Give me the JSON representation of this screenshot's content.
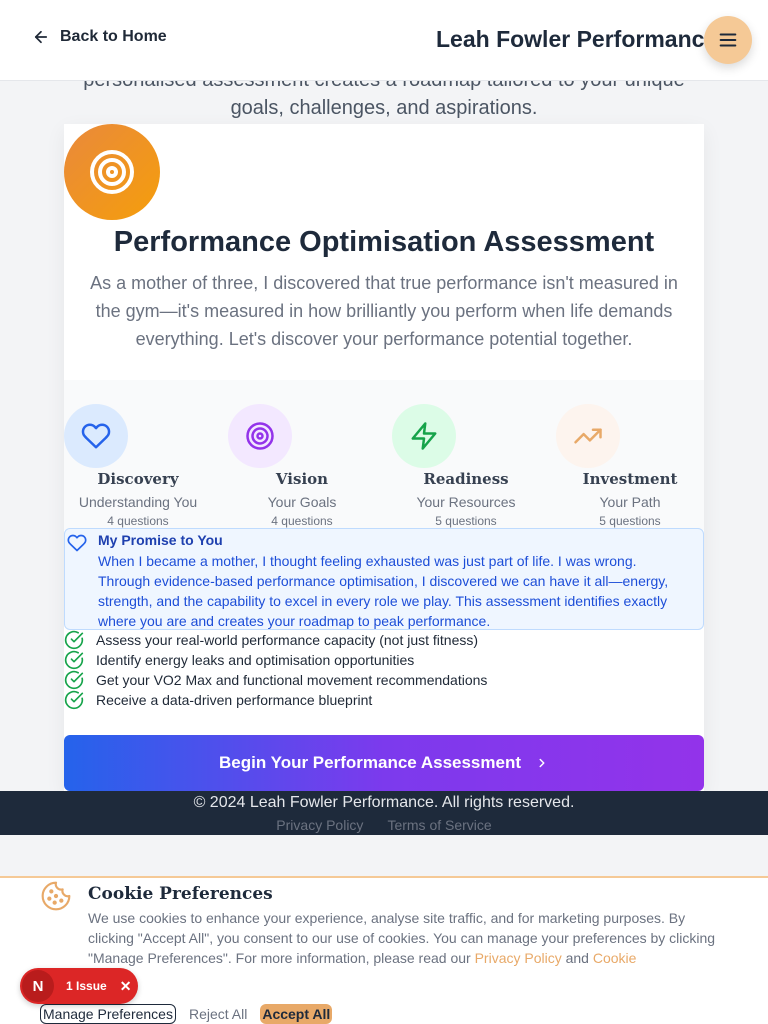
{
  "header": {
    "back_label": "Back to Home",
    "brand": "Leah Fowler Performance"
  },
  "intro": {
    "line1": "personalised assessment creates a roadmap tailored to your unique",
    "line2": "goals, challenges, and aspirations."
  },
  "card": {
    "title": "Performance Optimisation Assessment",
    "description": "As a mother of three, I discovered that true performance isn't measured in the gym—it's measured in how brilliantly you perform when life demands everything. Let's discover your performance potential together."
  },
  "steps": [
    {
      "title": "Discovery",
      "subtitle": "Understanding You",
      "count": "4 questions",
      "icon": "heart-icon",
      "color": "#2563eb",
      "bg": "#dbeafe"
    },
    {
      "title": "Vision",
      "subtitle": "Your Goals",
      "count": "4 questions",
      "icon": "target-icon",
      "color": "#9333ea",
      "bg": "#f3e8ff"
    },
    {
      "title": "Readiness",
      "subtitle": "Your Resources",
      "count": "5 questions",
      "icon": "zap-icon",
      "color": "#16a34a",
      "bg": "#dcfce7"
    },
    {
      "title": "Investment",
      "subtitle": "Your Path",
      "count": "5 questions",
      "icon": "trending-up-icon",
      "color": "#e8a968",
      "bg": "#fdf4ee"
    }
  ],
  "promise": {
    "title": "My Promise to You",
    "text": "When I became a mother, I thought feeling exhausted was just part of life. I was wrong. Through evidence-based performance optimisation, I discovered we can have it all—energy, strength, and the capability to excel in every role we play. This assessment identifies exactly where you are and creates your roadmap to peak performance."
  },
  "checklist": [
    "Assess your real-world performance capacity (not just fitness)",
    "Identify energy leaks and optimisation opportunities",
    "Get your VO2 Max and functional movement recommendations",
    "Receive a data-driven performance blueprint"
  ],
  "cta": {
    "label": "Begin Your Performance Assessment"
  },
  "footer": {
    "copyright": "© 2024 Leah Fowler Performance. All rights reserved.",
    "privacy": "Privacy Policy",
    "terms": "Terms of Service"
  },
  "cookie": {
    "title": "Cookie Preferences",
    "text_before": "We use cookies to enhance your experience, analyse site traffic, and for marketing purposes. By clicking \"Accept All\", you consent to our use of cookies. You can manage your preferences by clicking \"Manage Preferences\". For more information, please read our ",
    "privacy_link": "Privacy Policy",
    "and": " and ",
    "cookie_link": "Cookie",
    "manage": "Manage Preferences",
    "reject": "Reject All",
    "accept": "Accept All"
  },
  "issue_badge": {
    "logo": "N",
    "label": "1 Issue"
  },
  "colors": {
    "accent": "#e8a968",
    "navy": "#1e2a3b",
    "cta_start": "#2563eb",
    "cta_end": "#9333ea",
    "check": "#16a34a"
  }
}
